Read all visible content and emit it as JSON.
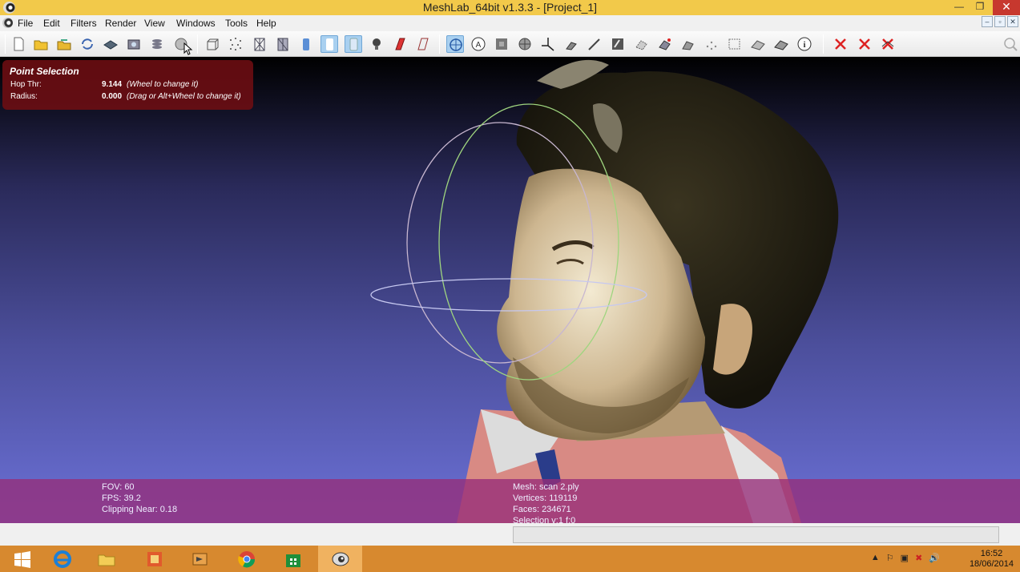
{
  "window": {
    "title": "MeshLab_64bit v1.3.3 - [Project_1]",
    "minimize_glyph": "—",
    "restore_glyph": "❐",
    "close_glyph": "✕"
  },
  "menu": {
    "items": [
      "File",
      "Edit",
      "Filters",
      "Render",
      "View",
      "Windows",
      "Tools",
      "Help"
    ],
    "mdi": [
      "–",
      "▫",
      "✕"
    ]
  },
  "toolbar": {
    "icons": [
      "new-file-icon",
      "open-folder-icon",
      "open-project-icon",
      "reload-icon",
      "save-layer-icon",
      "snapshot-icon",
      "layers-icon",
      "mesh-shade-icon",
      "bounding-box-icon",
      "points-icon",
      "wireframe-icon",
      "hidden-lines-icon",
      "flat-shading-icon",
      "smooth-shading-icon",
      "texture-icon",
      "lighting-icon",
      "double-side-icon",
      "fancy-light-icon",
      "trackball-icon",
      "annotation-icon",
      "measure-icon",
      "sphere-icon",
      "axis-icon",
      "paint-icon",
      "brush-icon",
      "texture-paint-icon",
      "select-vertex-icon",
      "select-face-icon",
      "select-cc-icon",
      "select-point-icon",
      "select-area-icon",
      "align-icon",
      "align-manual-icon",
      "info-icon",
      "delete-vertex-icon",
      "delete-face-icon",
      "delete-selection-icon",
      "search-icon"
    ]
  },
  "overlay": {
    "title": "Point Selection",
    "rows": [
      {
        "label": "Hop Thr:",
        "value": "9.144",
        "hint": "(Wheel to change it)"
      },
      {
        "label": "Radius:",
        "value": "0.000",
        "hint": "(Drag or Alt+Wheel to change it)"
      }
    ]
  },
  "info": {
    "fov": "FOV: 60",
    "fps": "FPS:   39.2",
    "clipping": "Clipping Near:  0.18",
    "mesh": "Mesh: scan 2.ply",
    "vertices": "Vertices: 119119",
    "faces": "Faces: 234671",
    "selection": "Selection v:1 f:0"
  },
  "taskbar": {
    "apps": [
      "start-icon",
      "internet-explorer-icon",
      "file-explorer-icon",
      "store-app-icon",
      "media-app-icon",
      "chrome-icon",
      "windows-store-icon",
      "meshlab-icon"
    ],
    "time": "16:52",
    "date": "18/06/2014",
    "tray": [
      "▲",
      "⚐",
      "▣",
      "✖",
      "🔊"
    ]
  },
  "colors": {
    "titlebar": "#f2c94a",
    "overlay_panel": "#6e0e12",
    "info_band": "#962d78",
    "taskbar": "#d7892f"
  }
}
